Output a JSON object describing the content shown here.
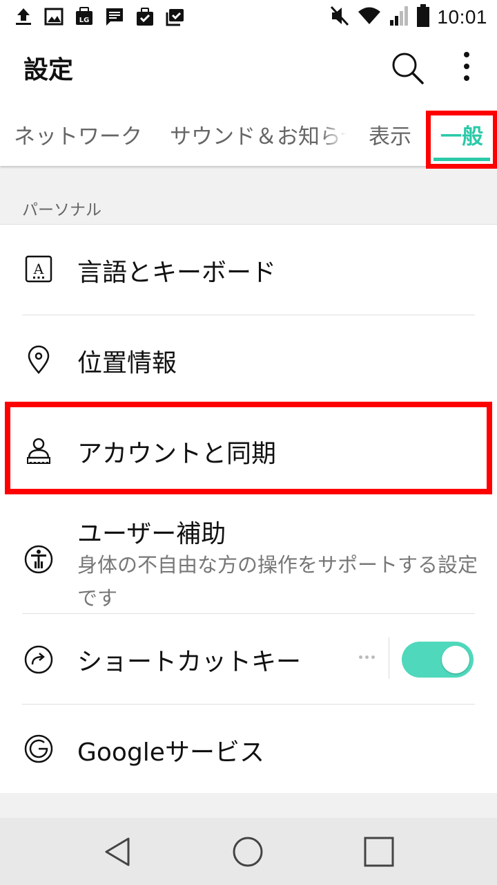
{
  "status_bar": {
    "time": "10:01",
    "notification_icons": [
      "upload-icon",
      "image-icon",
      "lg-icon",
      "message-icon",
      "bag-check-icon",
      "bag-check-icon"
    ],
    "system_icons": [
      "mute-icon",
      "wifi-icon",
      "signal-icon",
      "battery-icon"
    ]
  },
  "app_bar": {
    "title": "設定",
    "actions": [
      "search-icon",
      "more-vert-icon"
    ]
  },
  "tabs": [
    {
      "label": "ネットワーク",
      "selected": false
    },
    {
      "label": "サウンド＆お知らせ",
      "selected": false
    },
    {
      "label": "表示",
      "selected": false
    },
    {
      "label": "一般",
      "selected": true
    }
  ],
  "section": {
    "header": "パーソナル",
    "items": [
      {
        "label": "言語とキーボード",
        "icon": "language-icon"
      },
      {
        "label": "位置情報",
        "icon": "location-pin-icon"
      },
      {
        "label": "アカウントと同期",
        "icon": "account-icon"
      },
      {
        "label": "ユーザー補助",
        "subtitle": "身体の不自由な方の操作をサポートする設定です",
        "icon": "accessibility-icon"
      },
      {
        "label": "ショートカットキー",
        "icon": "shortcut-icon",
        "toggle_on": true
      },
      {
        "label": "Googleサービス",
        "icon": "google-icon"
      }
    ]
  },
  "colors": {
    "accent": "#2bc9a8",
    "toggle": "#4fd8bb",
    "highlight": "#ff0000"
  },
  "nav_bar": [
    "back-icon",
    "home-icon",
    "recent-apps-icon"
  ]
}
